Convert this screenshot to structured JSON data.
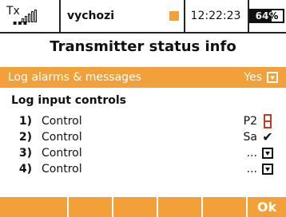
{
  "status_bar": {
    "tx_label": "Tx",
    "model_name": "vychozi",
    "time": "12:22:23",
    "battery_percent_text": "64%",
    "battery_level": 0.64,
    "indicator_color": "#F2A13A"
  },
  "title": "Transmitter status info",
  "selected_row": {
    "label": "Log alarms & messages",
    "value": "Yes",
    "icon": "dropdown-arrow-icon"
  },
  "section_title": "Log input controls",
  "controls": [
    {
      "num": "1)",
      "label": "Control",
      "value": "P2",
      "icon": "potentiometer-icon"
    },
    {
      "num": "2)",
      "label": "Control",
      "value": "Sa",
      "icon": "checkmark-icon"
    },
    {
      "num": "3)",
      "label": "Control",
      "value": "...",
      "icon": "dropdown-arrow-icon"
    },
    {
      "num": "4)",
      "label": "Control",
      "value": "...",
      "icon": "dropdown-arrow-icon"
    }
  ],
  "bottom_buttons": [
    "",
    "",
    "",
    "",
    "",
    "Ok"
  ],
  "colors": {
    "accent": "#F2A13A",
    "text": "#111111",
    "background": "#FFFFFF",
    "pot_red": "#C23A2B"
  }
}
